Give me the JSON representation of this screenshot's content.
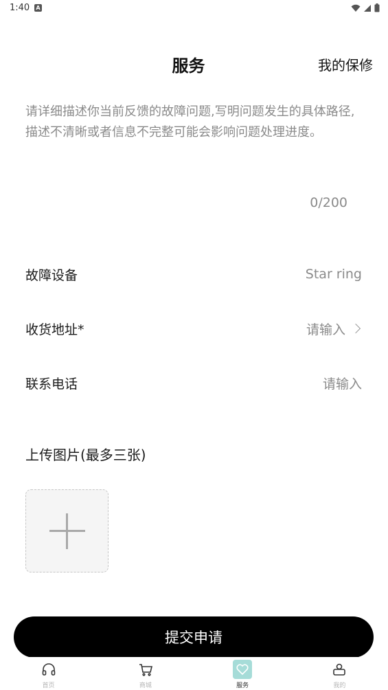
{
  "status_bar": {
    "time": "1:40",
    "notification_icon": "a-icon"
  },
  "header": {
    "title": "服务",
    "warranty_link": "我的保修"
  },
  "description": {
    "placeholder": "请详细描述你当前反馈的故障问题,写明问题发生的具体路径,描述不清晰或者信息不完整可能会影响问题处理进度。",
    "counter": "0/200"
  },
  "form": {
    "rows": [
      {
        "label": "故障设备",
        "value": "Star ring"
      },
      {
        "label": "收货地址*",
        "value": "请输入"
      },
      {
        "label": "联系电话",
        "value": "请输入"
      }
    ]
  },
  "upload": {
    "title": "上传图片(最多三张)"
  },
  "submit": {
    "label": "提交申请"
  },
  "tabs": [
    {
      "label": "首页",
      "icon": "headphones-icon"
    },
    {
      "label": "商城",
      "icon": "cart-icon"
    },
    {
      "label": "服务",
      "icon": "heart-icon"
    },
    {
      "label": "我的",
      "icon": "profile-icon"
    }
  ],
  "colors": {
    "accent": "#a6dcd8",
    "primary_button": "#000000",
    "muted_text": "#8a8a8a"
  }
}
